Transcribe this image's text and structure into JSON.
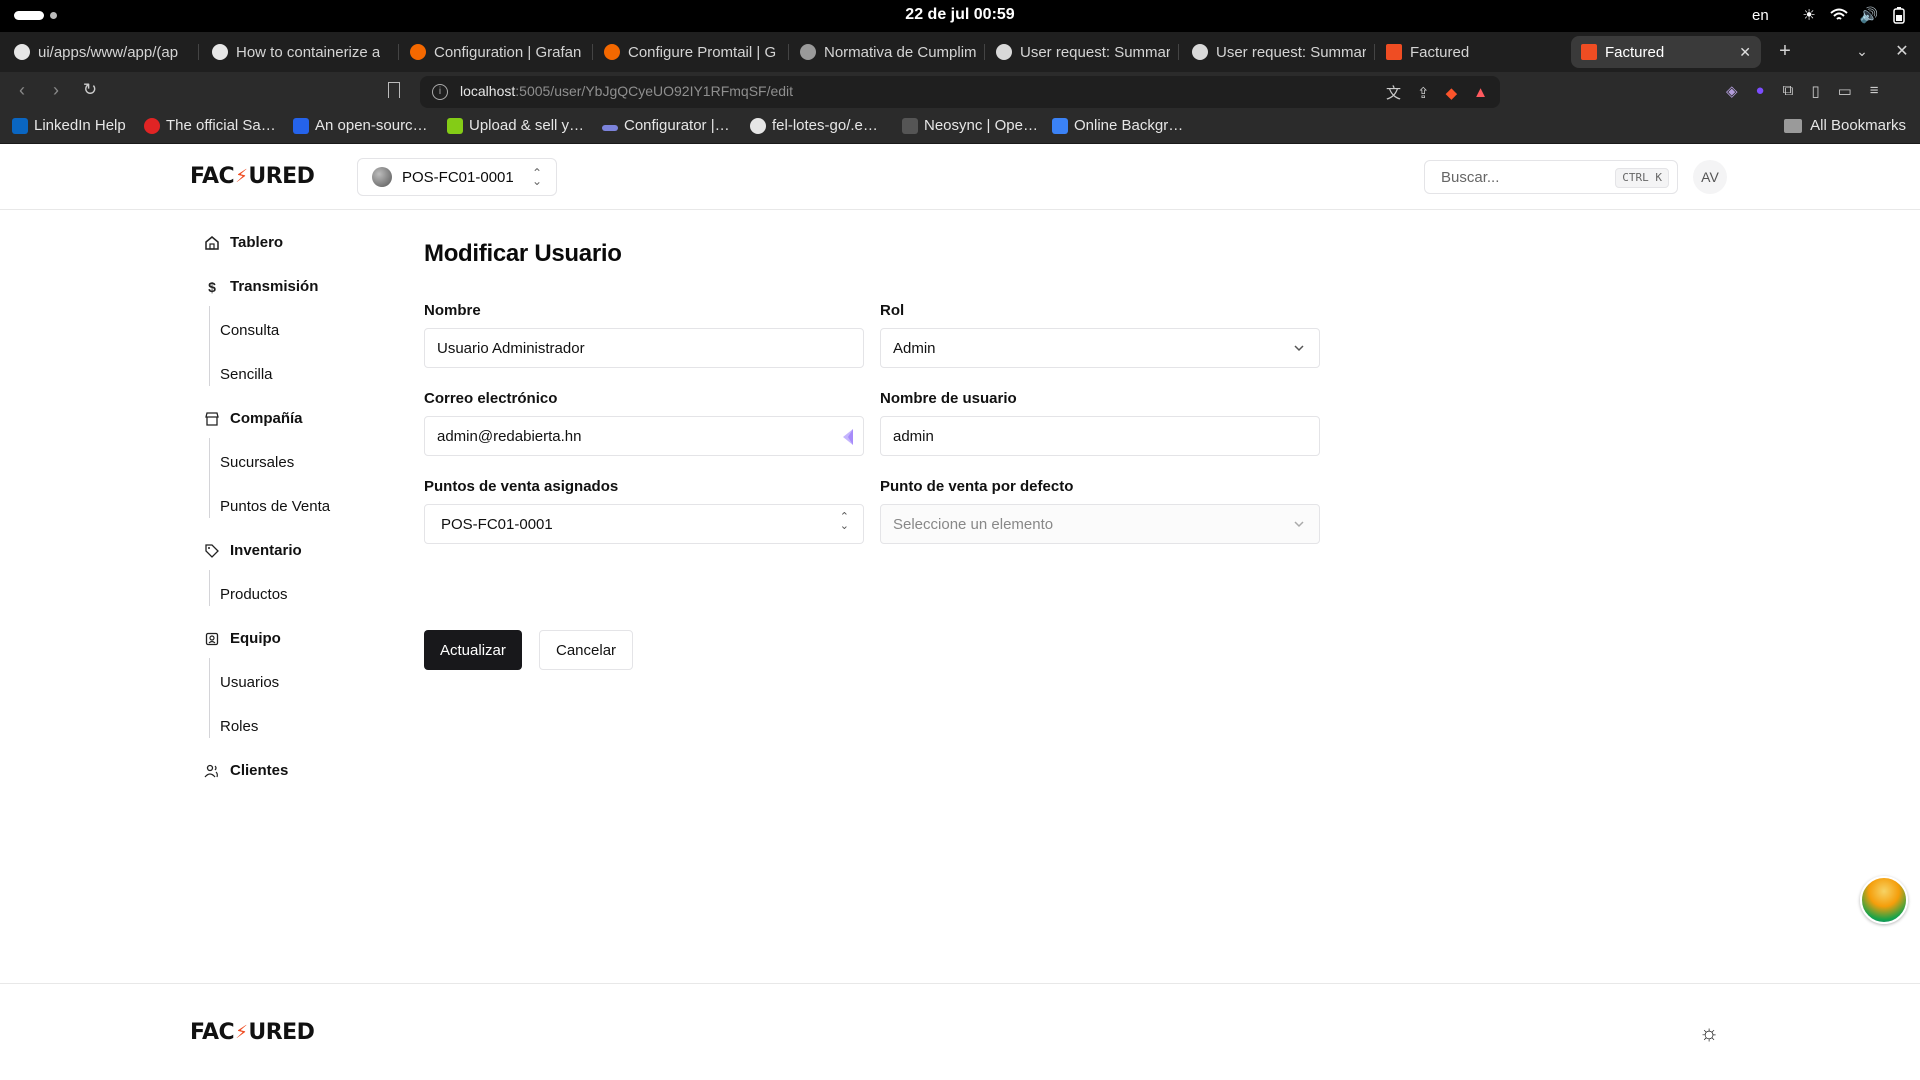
{
  "os": {
    "clock": "22 de jul  00:59",
    "lang": "en"
  },
  "tabs": [
    {
      "label": "ui/apps/www/app/(ap",
      "favicon_color": "#e6e6e6"
    },
    {
      "label": "How to containerize a",
      "favicon_color": "#e6e6e6"
    },
    {
      "label": "Configuration | Grafan",
      "favicon_color": "#f46800"
    },
    {
      "label": "Configure Promtail | G",
      "favicon_color": "#f46800"
    },
    {
      "label": "Normativa de Cumplim",
      "favicon_color": "#9a9a9a"
    },
    {
      "label": "User request: Summar",
      "favicon_color": "#d9d9d9"
    },
    {
      "label": "User request: Summar",
      "favicon_color": "#d9d9d9"
    },
    {
      "label": "Factured",
      "favicon_color": "#ef4d23"
    },
    {
      "label": "Factured",
      "favicon_color": "#ef4d23",
      "active": true
    }
  ],
  "address": {
    "host": "localhost",
    "path": ":5005/user/YbJgQCyeUO92IY1RFmqSF/edit"
  },
  "bookmarks": [
    {
      "label": "LinkedIn Help",
      "color": "#0a66c2"
    },
    {
      "label": "The official Sa…",
      "color": "#e02424"
    },
    {
      "label": "An open-sourc…",
      "color": "#2563eb"
    },
    {
      "label": "Upload & sell y…",
      "color": "#84cc16"
    },
    {
      "label": "Configurator |…",
      "color": "#7c83db"
    },
    {
      "label": "fel-lotes-go/.e…",
      "color": "#e6e6e6"
    },
    {
      "label": "Neosync | Ope…",
      "color": "#555555"
    },
    {
      "label": "Online Backgr…",
      "color": "#3b82f6"
    }
  ],
  "bookmarks_all": "All Bookmarks",
  "header": {
    "logo_left": "FAC",
    "logo_right": "URED",
    "pos_selector": "POS-FC01-0001",
    "search_placeholder": "Buscar...",
    "search_shortcut": "CTRL K",
    "user_initials": "AV"
  },
  "sidebar": {
    "tablero": "Tablero",
    "transmision": "Transmisión",
    "consulta": "Consulta",
    "sencilla": "Sencilla",
    "compania": "Compañía",
    "sucursales": "Sucursales",
    "puntos_de_venta": "Puntos de Venta",
    "inventario": "Inventario",
    "productos": "Productos",
    "equipo": "Equipo",
    "usuarios": "Usuarios",
    "roles": "Roles",
    "clientes": "Clientes"
  },
  "form": {
    "title": "Modificar Usuario",
    "nombre_label": "Nombre",
    "nombre_value": "Usuario Administrador",
    "rol_label": "Rol",
    "rol_value": "Admin",
    "correo_label": "Correo electrónico",
    "correo_value": "admin@redabierta.hn",
    "username_label": "Nombre de usuario",
    "username_value": "admin",
    "pos_asignados_label": "Puntos de venta asignados",
    "pos_asignados_value": "POS-FC01-0001",
    "pos_defecto_label": "Punto de venta por defecto",
    "pos_defecto_placeholder": "Seleccione un elemento",
    "submit": "Actualizar",
    "cancel": "Cancelar"
  },
  "colors": {
    "brand_accent": "#ef4d23",
    "primary_button": "#18181b"
  }
}
